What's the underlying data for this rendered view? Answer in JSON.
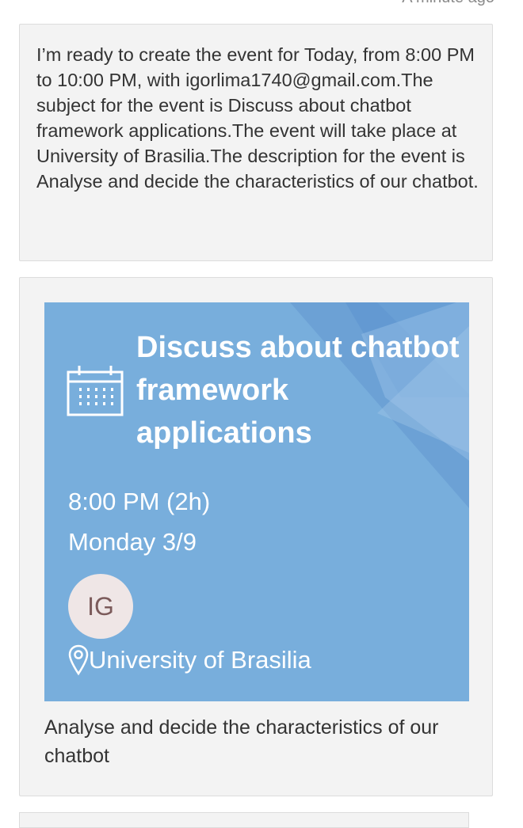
{
  "header": {
    "timestamp": "A minute ago"
  },
  "bot_message": {
    "text": "I’m ready to create the event for Today, from 8:00 PM to 10:00 PM, with igorlima1740@gmail.com.The subject for the event is Discuss about chatbot framework applications.The event will take place at University of Brasilia.The description for the event is Analyse and decide the characteristics of our chatbot."
  },
  "event_card": {
    "title": "Discuss about chatbot framework applications",
    "time": "8:00 PM (2h)",
    "date": "Monday 3/9",
    "attendee_initials": "IG",
    "location": "University of Brasilia",
    "description": "Analyse and decide the characteristics of our chatbot",
    "icons": [
      "calendar-icon",
      "location-pin-icon"
    ],
    "colors": {
      "hero_background": "#78aedc",
      "bubble_background": "#f3f3f3",
      "avatar_background": "#efe6e6"
    }
  }
}
